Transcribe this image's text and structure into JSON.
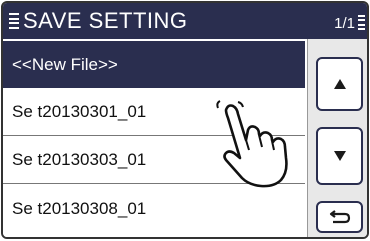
{
  "title": "SAVE SETTING",
  "page": "1/1",
  "list": [
    {
      "label": "<<New File>>",
      "selected": true
    },
    {
      "label": "Se t20130301_01",
      "selected": false
    },
    {
      "label": "Se t20130303_01",
      "selected": false
    },
    {
      "label": "Se t20130308_01",
      "selected": false
    }
  ],
  "icons": {
    "up": "triangle-up-icon",
    "down": "triangle-down-icon",
    "back": "return-arrow-icon",
    "touch": "pointing-hand-icon",
    "menu": "menu-lines-icon"
  },
  "colors": {
    "titlebar": "#2a2e4f",
    "selected_row": "#2a2e4f",
    "panel": "#e8e8e8"
  }
}
